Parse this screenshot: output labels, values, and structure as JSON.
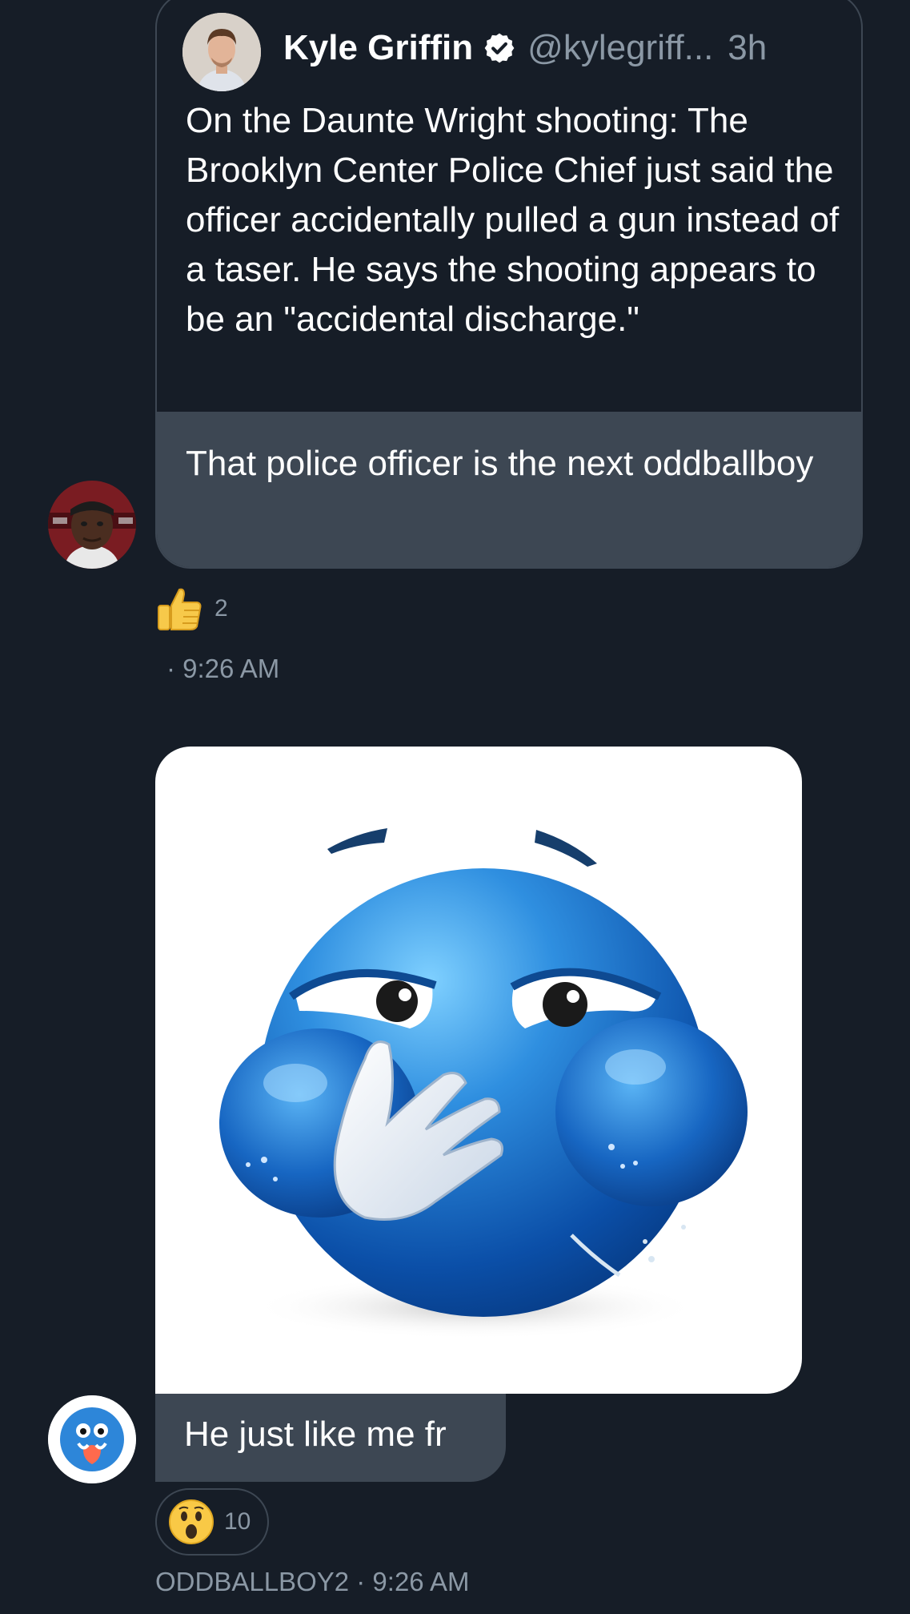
{
  "quoted_tweet": {
    "author_name": "Kyle Griffin",
    "handle": "@kylegriff...",
    "time": "3h",
    "text": "On the Daunte Wright shooting: The Brooklyn Center Police Chief just said the officer accidentally pulled a gun instead of a taser. He says the shooting appears to be an \"accidental discharge.\""
  },
  "message1": {
    "text": "That police officer is the next oddballboy",
    "reaction_count": "2",
    "timestamp": "· 9:26 AM"
  },
  "message2": {
    "text": "He just like me fr",
    "reaction_count": "10",
    "meta": "ODDBALLBOY2 · 9:26 AM"
  },
  "icons": {
    "verified": "verified-badge-icon",
    "thumbs_up": "thumbs-up-icon",
    "surprised": "surprised-face-icon"
  },
  "colors": {
    "background": "#161d27",
    "bubble": "#3d4753",
    "secondary_text": "#8b98a5"
  }
}
